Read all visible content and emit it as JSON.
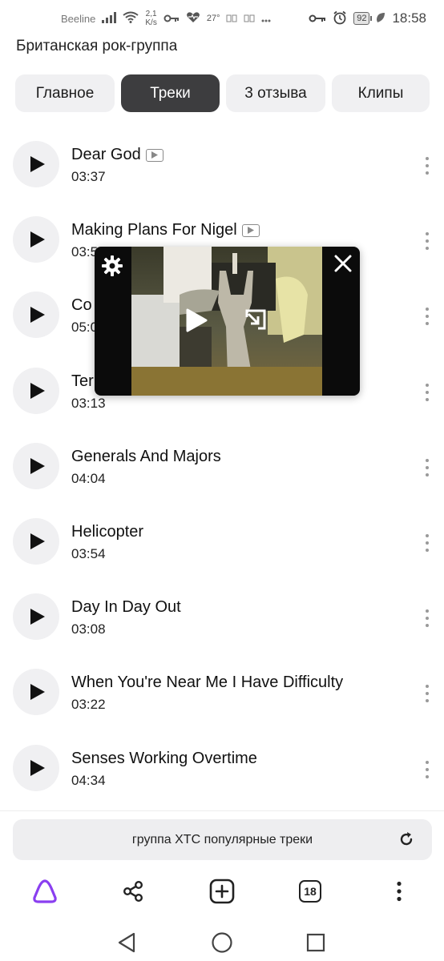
{
  "status_bar": {
    "carrier": "Beeline",
    "speed": "2,1",
    "speed_unit": "K/s",
    "temperature": "27°",
    "battery": "92",
    "time": "18:58"
  },
  "header": {
    "subtitle": "Британская рок-группа"
  },
  "tabs": [
    {
      "label": "Главное",
      "active": false
    },
    {
      "label": "Треки",
      "active": true
    },
    {
      "label": "3 отзыва",
      "active": false
    },
    {
      "label": "Клипы",
      "active": false
    }
  ],
  "tracks": [
    {
      "title": "Dear God",
      "duration": "03:37",
      "has_video": true
    },
    {
      "title": "Making Plans For Nigel",
      "duration": "03:5",
      "has_video": true
    },
    {
      "title": "Co",
      "duration": "05:0",
      "has_video": false
    },
    {
      "title": "Ter",
      "duration": "03:13",
      "has_video": false
    },
    {
      "title": "Generals And Majors",
      "duration": "04:04",
      "has_video": false
    },
    {
      "title": "Helicopter",
      "duration": "03:54",
      "has_video": false
    },
    {
      "title": "Day In Day Out",
      "duration": "03:08",
      "has_video": false
    },
    {
      "title": "When You're Near Me I Have Difficulty",
      "duration": "03:22",
      "has_video": false
    },
    {
      "title": "Senses Working Overtime",
      "duration": "04:34",
      "has_video": false
    }
  ],
  "video_popup": {
    "icons": [
      "gear-icon",
      "close-icon",
      "play-icon",
      "expand-icon"
    ]
  },
  "search": {
    "query": "группа XTC популярные треки"
  },
  "bottom_nav": {
    "tab_count": "18",
    "icons": [
      "alice-icon",
      "share-icon",
      "add-tab-icon",
      "tabs-icon",
      "menu-icon"
    ]
  },
  "system_nav": {
    "icons": [
      "back-icon",
      "home-icon",
      "recents-icon"
    ]
  },
  "colors": {
    "accent": "#8a3ff0",
    "active_tab": "#3d3d3f",
    "chip_bg": "#f0f0f2"
  }
}
